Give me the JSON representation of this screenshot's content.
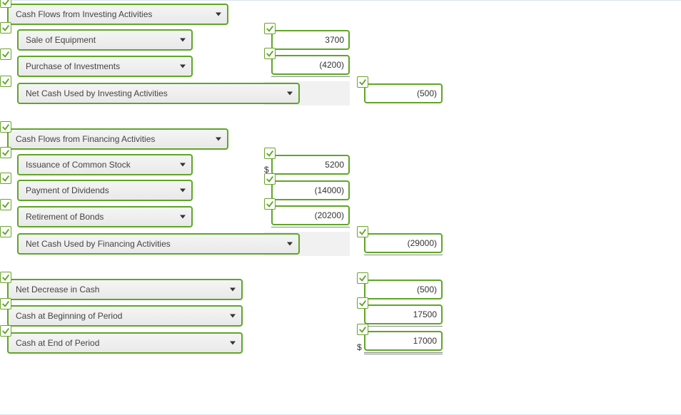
{
  "investing": {
    "header": "Cash Flows from Investing Activities",
    "items": [
      {
        "label": "Sale of Equipment",
        "value": "3700"
      },
      {
        "label": "Purchase of Investments",
        "value": "(4200)"
      }
    ],
    "total_label": "Net Cash Used by Investing Activities",
    "total_value": "(500)"
  },
  "financing": {
    "header": "Cash Flows from Financing Activities",
    "items": [
      {
        "label": "Issuance of Common Stock",
        "value": "5200",
        "currency": "$"
      },
      {
        "label": "Payment of Dividends",
        "value": "(14000)"
      },
      {
        "label": "Retirement of Bonds",
        "value": "(20200)"
      }
    ],
    "total_label": "Net Cash Used by Financing Activities",
    "total_value": "(29000)"
  },
  "summary": {
    "rows": [
      {
        "label": "Net Decrease in Cash",
        "value": "(500)"
      },
      {
        "label": "Cash at Beginning of Period",
        "value": "17500"
      },
      {
        "label": "Cash at End of Period",
        "value": "17000",
        "currency": "$"
      }
    ]
  }
}
